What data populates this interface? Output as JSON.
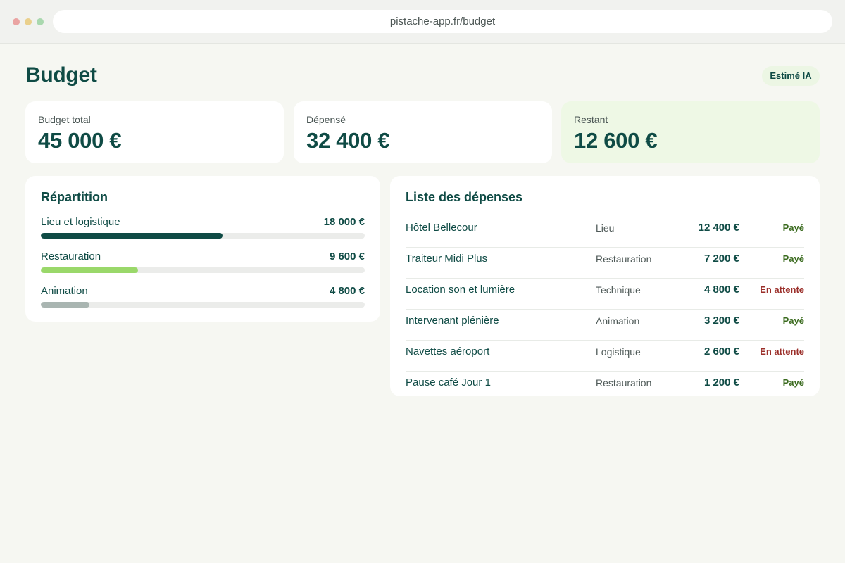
{
  "browser": {
    "url": "pistache-app.fr/budget"
  },
  "page": {
    "title": "Budget",
    "badge": "Estimé IA"
  },
  "stats": [
    {
      "label": "Budget total",
      "value": "45 000 €"
    },
    {
      "label": "Dépensé",
      "value": "32 400 €"
    },
    {
      "label": "Restant",
      "value": "12 600 €"
    }
  ],
  "repartition": {
    "title": "Répartition",
    "items": [
      {
        "label": "Lieu et logistique",
        "amount": "18 000 €",
        "fraction": 0.56,
        "color": "#0f4b45"
      },
      {
        "label": "Restauration",
        "amount": "9 600 €",
        "fraction": 0.3,
        "color": "#9ad86a"
      },
      {
        "label": "Animation",
        "amount": "4 800 €",
        "fraction": 0.15,
        "color": "#a9b5b1"
      }
    ]
  },
  "expenses": {
    "title": "Liste des dépenses",
    "rows": [
      {
        "name": "Hôtel Bellecour",
        "category": "Lieu",
        "amount": "12 400 €",
        "status": "Payé",
        "status_kind": "paid"
      },
      {
        "name": "Traiteur Midi Plus",
        "category": "Restauration",
        "amount": "7 200 €",
        "status": "Payé",
        "status_kind": "paid"
      },
      {
        "name": "Location son et lumière",
        "category": "Technique",
        "amount": "4 800 €",
        "status": "En attente",
        "status_kind": "pending"
      },
      {
        "name": "Intervenant plénière",
        "category": "Animation",
        "amount": "3 200 €",
        "status": "Payé",
        "status_kind": "paid"
      },
      {
        "name": "Navettes aéroport",
        "category": "Logistique",
        "amount": "2 600 €",
        "status": "En attente",
        "status_kind": "pending"
      },
      {
        "name": "Pause café Jour 1",
        "category": "Restauration",
        "amount": "1 200 €",
        "status": "Payé",
        "status_kind": "paid"
      }
    ]
  }
}
